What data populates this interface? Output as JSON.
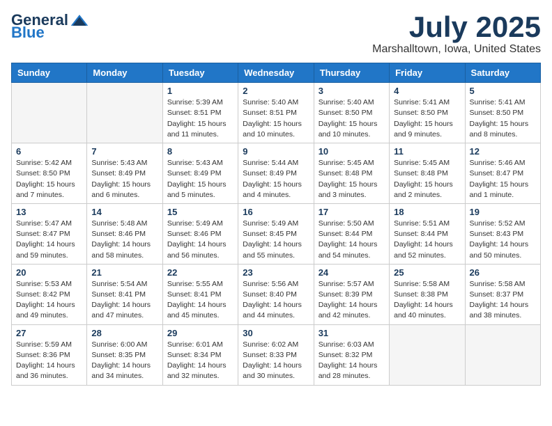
{
  "header": {
    "logo_general": "General",
    "logo_blue": "Blue",
    "month_title": "July 2025",
    "location": "Marshalltown, Iowa, United States"
  },
  "weekdays": [
    "Sunday",
    "Monday",
    "Tuesday",
    "Wednesday",
    "Thursday",
    "Friday",
    "Saturday"
  ],
  "weeks": [
    [
      {
        "day": "",
        "sunrise": "",
        "sunset": "",
        "daylight": ""
      },
      {
        "day": "",
        "sunrise": "",
        "sunset": "",
        "daylight": ""
      },
      {
        "day": "1",
        "sunrise": "Sunrise: 5:39 AM",
        "sunset": "Sunset: 8:51 PM",
        "daylight": "Daylight: 15 hours and 11 minutes."
      },
      {
        "day": "2",
        "sunrise": "Sunrise: 5:40 AM",
        "sunset": "Sunset: 8:51 PM",
        "daylight": "Daylight: 15 hours and 10 minutes."
      },
      {
        "day": "3",
        "sunrise": "Sunrise: 5:40 AM",
        "sunset": "Sunset: 8:50 PM",
        "daylight": "Daylight: 15 hours and 10 minutes."
      },
      {
        "day": "4",
        "sunrise": "Sunrise: 5:41 AM",
        "sunset": "Sunset: 8:50 PM",
        "daylight": "Daylight: 15 hours and 9 minutes."
      },
      {
        "day": "5",
        "sunrise": "Sunrise: 5:41 AM",
        "sunset": "Sunset: 8:50 PM",
        "daylight": "Daylight: 15 hours and 8 minutes."
      }
    ],
    [
      {
        "day": "6",
        "sunrise": "Sunrise: 5:42 AM",
        "sunset": "Sunset: 8:50 PM",
        "daylight": "Daylight: 15 hours and 7 minutes."
      },
      {
        "day": "7",
        "sunrise": "Sunrise: 5:43 AM",
        "sunset": "Sunset: 8:49 PM",
        "daylight": "Daylight: 15 hours and 6 minutes."
      },
      {
        "day": "8",
        "sunrise": "Sunrise: 5:43 AM",
        "sunset": "Sunset: 8:49 PM",
        "daylight": "Daylight: 15 hours and 5 minutes."
      },
      {
        "day": "9",
        "sunrise": "Sunrise: 5:44 AM",
        "sunset": "Sunset: 8:49 PM",
        "daylight": "Daylight: 15 hours and 4 minutes."
      },
      {
        "day": "10",
        "sunrise": "Sunrise: 5:45 AM",
        "sunset": "Sunset: 8:48 PM",
        "daylight": "Daylight: 15 hours and 3 minutes."
      },
      {
        "day": "11",
        "sunrise": "Sunrise: 5:45 AM",
        "sunset": "Sunset: 8:48 PM",
        "daylight": "Daylight: 15 hours and 2 minutes."
      },
      {
        "day": "12",
        "sunrise": "Sunrise: 5:46 AM",
        "sunset": "Sunset: 8:47 PM",
        "daylight": "Daylight: 15 hours and 1 minute."
      }
    ],
    [
      {
        "day": "13",
        "sunrise": "Sunrise: 5:47 AM",
        "sunset": "Sunset: 8:47 PM",
        "daylight": "Daylight: 14 hours and 59 minutes."
      },
      {
        "day": "14",
        "sunrise": "Sunrise: 5:48 AM",
        "sunset": "Sunset: 8:46 PM",
        "daylight": "Daylight: 14 hours and 58 minutes."
      },
      {
        "day": "15",
        "sunrise": "Sunrise: 5:49 AM",
        "sunset": "Sunset: 8:46 PM",
        "daylight": "Daylight: 14 hours and 56 minutes."
      },
      {
        "day": "16",
        "sunrise": "Sunrise: 5:49 AM",
        "sunset": "Sunset: 8:45 PM",
        "daylight": "Daylight: 14 hours and 55 minutes."
      },
      {
        "day": "17",
        "sunrise": "Sunrise: 5:50 AM",
        "sunset": "Sunset: 8:44 PM",
        "daylight": "Daylight: 14 hours and 54 minutes."
      },
      {
        "day": "18",
        "sunrise": "Sunrise: 5:51 AM",
        "sunset": "Sunset: 8:44 PM",
        "daylight": "Daylight: 14 hours and 52 minutes."
      },
      {
        "day": "19",
        "sunrise": "Sunrise: 5:52 AM",
        "sunset": "Sunset: 8:43 PM",
        "daylight": "Daylight: 14 hours and 50 minutes."
      }
    ],
    [
      {
        "day": "20",
        "sunrise": "Sunrise: 5:53 AM",
        "sunset": "Sunset: 8:42 PM",
        "daylight": "Daylight: 14 hours and 49 minutes."
      },
      {
        "day": "21",
        "sunrise": "Sunrise: 5:54 AM",
        "sunset": "Sunset: 8:41 PM",
        "daylight": "Daylight: 14 hours and 47 minutes."
      },
      {
        "day": "22",
        "sunrise": "Sunrise: 5:55 AM",
        "sunset": "Sunset: 8:41 PM",
        "daylight": "Daylight: 14 hours and 45 minutes."
      },
      {
        "day": "23",
        "sunrise": "Sunrise: 5:56 AM",
        "sunset": "Sunset: 8:40 PM",
        "daylight": "Daylight: 14 hours and 44 minutes."
      },
      {
        "day": "24",
        "sunrise": "Sunrise: 5:57 AM",
        "sunset": "Sunset: 8:39 PM",
        "daylight": "Daylight: 14 hours and 42 minutes."
      },
      {
        "day": "25",
        "sunrise": "Sunrise: 5:58 AM",
        "sunset": "Sunset: 8:38 PM",
        "daylight": "Daylight: 14 hours and 40 minutes."
      },
      {
        "day": "26",
        "sunrise": "Sunrise: 5:58 AM",
        "sunset": "Sunset: 8:37 PM",
        "daylight": "Daylight: 14 hours and 38 minutes."
      }
    ],
    [
      {
        "day": "27",
        "sunrise": "Sunrise: 5:59 AM",
        "sunset": "Sunset: 8:36 PM",
        "daylight": "Daylight: 14 hours and 36 minutes."
      },
      {
        "day": "28",
        "sunrise": "Sunrise: 6:00 AM",
        "sunset": "Sunset: 8:35 PM",
        "daylight": "Daylight: 14 hours and 34 minutes."
      },
      {
        "day": "29",
        "sunrise": "Sunrise: 6:01 AM",
        "sunset": "Sunset: 8:34 PM",
        "daylight": "Daylight: 14 hours and 32 minutes."
      },
      {
        "day": "30",
        "sunrise": "Sunrise: 6:02 AM",
        "sunset": "Sunset: 8:33 PM",
        "daylight": "Daylight: 14 hours and 30 minutes."
      },
      {
        "day": "31",
        "sunrise": "Sunrise: 6:03 AM",
        "sunset": "Sunset: 8:32 PM",
        "daylight": "Daylight: 14 hours and 28 minutes."
      },
      {
        "day": "",
        "sunrise": "",
        "sunset": "",
        "daylight": ""
      },
      {
        "day": "",
        "sunrise": "",
        "sunset": "",
        "daylight": ""
      }
    ]
  ]
}
